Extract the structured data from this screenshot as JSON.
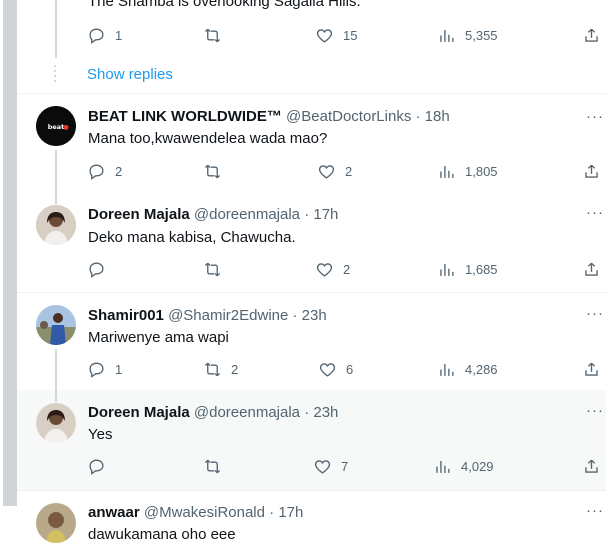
{
  "top_tweet": {
    "text": "The Shamba is overlooking Sagalla Hills.",
    "replies": "1",
    "retweets": "",
    "likes": "15",
    "views": "5,355"
  },
  "show_replies_label": "Show replies",
  "tweets": [
    {
      "name": "BEAT LINK WORLDWIDE™",
      "handle": "@BeatDoctorLinks",
      "time": "· 18h",
      "text": "Mana too,kwawendelea wada mao?",
      "replies": "2",
      "retweets": "",
      "likes": "2",
      "views": "1,805",
      "avatar_text": "beatlinks"
    },
    {
      "name": "Doreen Majala",
      "handle": "@doreenmajala",
      "time": "· 17h",
      "text": "Deko mana kabisa, Chawucha.",
      "replies": "",
      "retweets": "",
      "likes": "2",
      "views": "1,685"
    },
    {
      "name": "Shamir001",
      "handle": "@Shamir2Edwine",
      "time": "· 23h",
      "text": "Mariwenye ama wapi",
      "replies": "1",
      "retweets": "2",
      "likes": "6",
      "views": "4,286"
    },
    {
      "name": "Doreen Majala",
      "handle": "@doreenmajala",
      "time": "· 23h",
      "text": "Yes",
      "replies": "",
      "retweets": "",
      "likes": "7",
      "views": "4,029"
    },
    {
      "name": "anwaar",
      "handle": "@MwakesiRonald",
      "time": "· 17h",
      "text": "dawukamana oho eee"
    }
  ],
  "more_label": "···",
  "colors": {
    "accent": "#1d9bf0",
    "muted": "#536471",
    "highlight_bg": "#f7f9f9"
  }
}
